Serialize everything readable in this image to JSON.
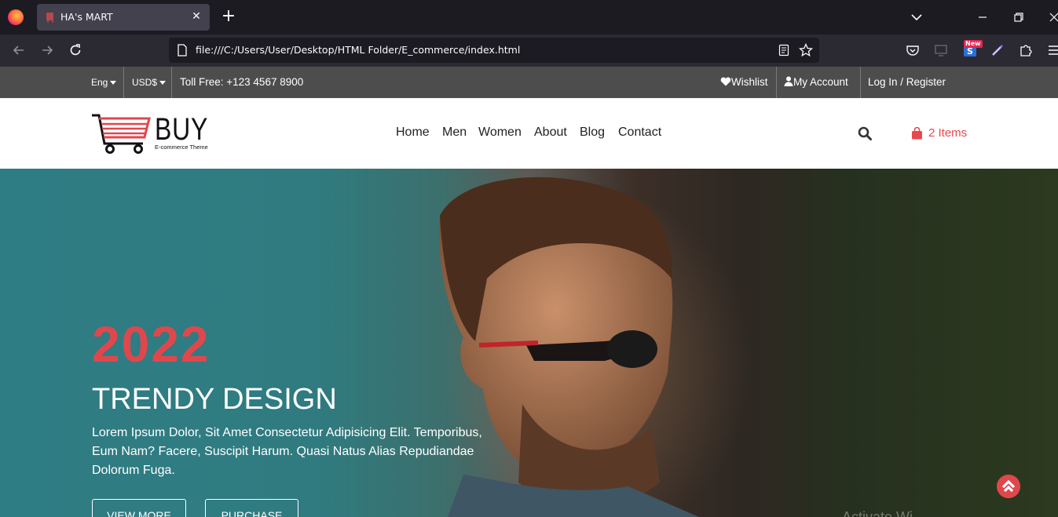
{
  "browser": {
    "tab_title": "HA's MART",
    "url": "file:///C:/Users/User/Desktop/HTML Folder/E_commerce/index.html",
    "extension_badge": "New"
  },
  "topbar": {
    "language": "Eng",
    "currency": "USD$",
    "toll_free": "Toll Free: +123 4567 8900",
    "wishlist": "Wishlist",
    "account": "My Account",
    "login": "Log In / Register"
  },
  "header": {
    "logo_text": "BUY",
    "logo_subtitle": "E-commerce Theme",
    "menu": [
      "Home",
      "Men",
      "Women",
      "About",
      "Blog",
      "Contact"
    ],
    "cart_label": "2 Items"
  },
  "hero": {
    "year": "2022",
    "title": "TRENDY DESIGN",
    "description": "Lorem Ipsum Dolor, Sit Amet Consectetur Adipisicing Elit. Temporibus, Eum Nam? Facere, Suscipit Harum. Quasi Natus Alias Repudiandae Dolorum Fuga.",
    "btn_view_more": "VIEW MORE",
    "btn_purchase": "PURCHASE",
    "watermark": "Activate Wi"
  },
  "colors": {
    "accent": "#e0474c",
    "topbar_bg": "#4d4d4d",
    "hero_teal": "#2f7d84"
  }
}
